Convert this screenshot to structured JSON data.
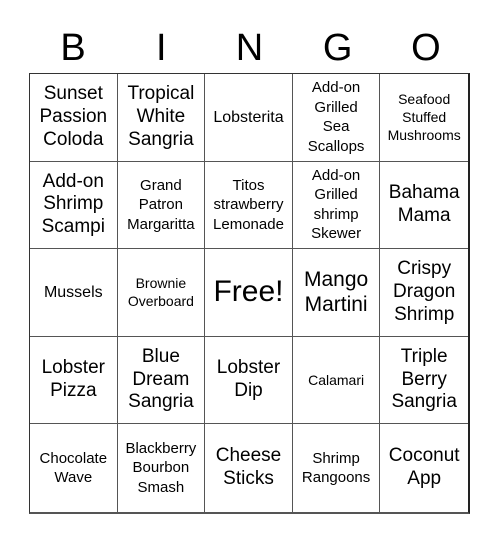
{
  "header": {
    "letters": [
      "B",
      "I",
      "N",
      "G",
      "O"
    ]
  },
  "cells": [
    {
      "text": "Sunset\nPassion\nColoda",
      "size": "s-md"
    },
    {
      "text": "Tropical\nWhite\nSangria",
      "size": "s-md"
    },
    {
      "text": "Lobsterita",
      "size": "s-md2"
    },
    {
      "text": "Add-on\nGrilled\nSea\nScallops",
      "size": "s-sm"
    },
    {
      "text": "Seafood\nStuffed\nMushrooms",
      "size": "s-xs"
    },
    {
      "text": "Add-on\nShrimp\nScampi",
      "size": "s-md"
    },
    {
      "text": "Grand\nPatron\nMargaritta",
      "size": "s-sm"
    },
    {
      "text": "Titos\nstrawberry\nLemonade",
      "size": "s-sm"
    },
    {
      "text": "Add-on\nGrilled\nshrimp\nSkewer",
      "size": "s-sm"
    },
    {
      "text": "Bahama\nMama",
      "size": "s-md"
    },
    {
      "text": "Mussels",
      "size": "s-md2"
    },
    {
      "text": "Brownie\nOverboard",
      "size": "s-xs"
    },
    {
      "text": "Free!",
      "size": "s-xl"
    },
    {
      "text": "Mango\nMartini",
      "size": "s-lg"
    },
    {
      "text": "Crispy\nDragon\nShrimp",
      "size": "s-md"
    },
    {
      "text": "Lobster\nPizza",
      "size": "s-md"
    },
    {
      "text": "Blue\nDream\nSangria",
      "size": "s-md"
    },
    {
      "text": "Lobster\nDip",
      "size": "s-md"
    },
    {
      "text": "Calamari",
      "size": "s-xs"
    },
    {
      "text": "Triple\nBerry\nSangria",
      "size": "s-md"
    },
    {
      "text": "Chocolate\nWave",
      "size": "s-sm"
    },
    {
      "text": "Blackberry\nBourbon\nSmash",
      "size": "s-sm"
    },
    {
      "text": "Cheese\nSticks",
      "size": "s-md"
    },
    {
      "text": "Shrimp\nRangoons",
      "size": "s-sm"
    },
    {
      "text": "Coconut\nApp",
      "size": "s-md"
    }
  ]
}
